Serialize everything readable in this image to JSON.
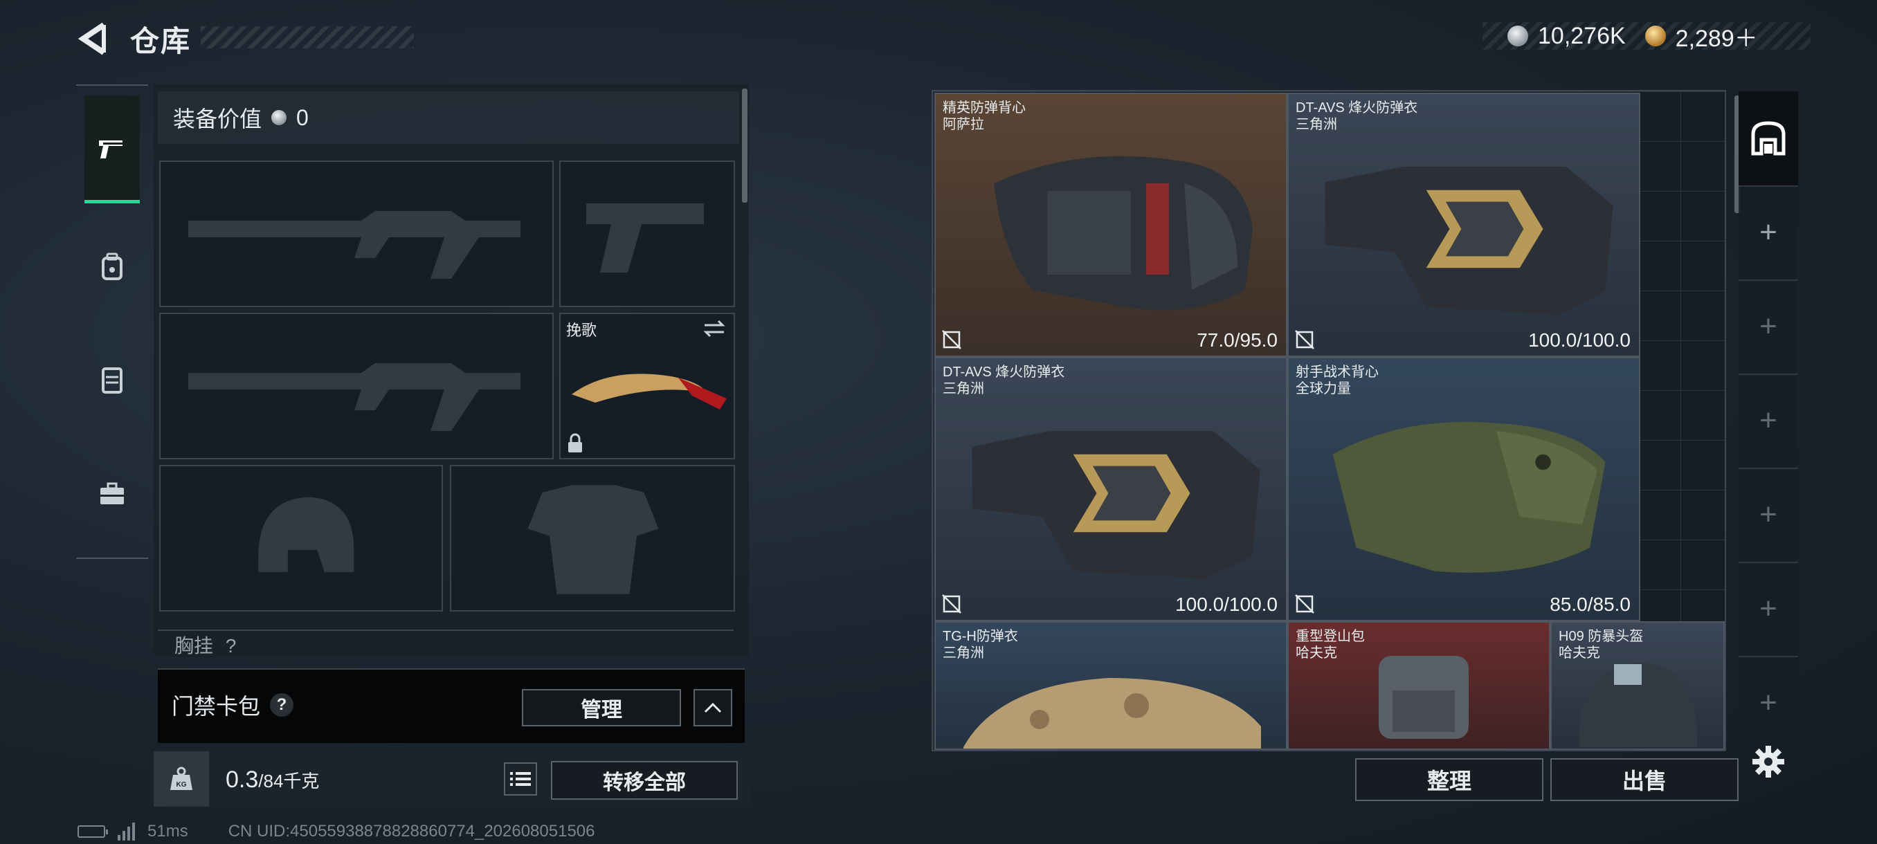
{
  "header": {
    "title": "仓库",
    "currency_silver": "10,276K",
    "currency_gold": "2,289＋"
  },
  "categories": [
    {
      "icon": "pistol-icon",
      "active": true
    },
    {
      "icon": "backpack-icon",
      "active": false
    },
    {
      "icon": "vest-icon",
      "active": false
    },
    {
      "icon": "toolbox-icon",
      "active": false
    }
  ],
  "loadout": {
    "equip_value_label": "装备价值",
    "equip_value": "0",
    "melee_name": "挽歌",
    "chest_rig_label": "胸挂",
    "chest_rig_help": "?"
  },
  "keycard": {
    "label": "门禁卡包",
    "help": "?",
    "manage": "管理"
  },
  "weight": {
    "current": "0.3",
    "max": "/84千克",
    "icon": "KG",
    "transfer_all": "转移全部"
  },
  "status": {
    "ping": "51ms",
    "uid": "CN UID:4505593887882886077​4_202608051506"
  },
  "stash": {
    "items": [
      {
        "name": "精英防弹背心",
        "sub": "阿萨拉",
        "durability": "77.0/95.0"
      },
      {
        "name": "DT-AVS 烽火防弹衣",
        "sub": "三角洲",
        "durability": "100.0/100.0"
      },
      {
        "name": "DT-AVS 烽火防弹衣",
        "sub": "三角洲",
        "durability": "100.0/100.0"
      },
      {
        "name": "射手战术背心",
        "sub": "全球力量",
        "durability": "85.0/85.0"
      },
      {
        "name": "TG-H防弹衣",
        "sub": "三角洲"
      },
      {
        "name": "重型登山包",
        "sub": "哈夫克"
      },
      {
        "name": "H09 防暴头盔",
        "sub": "哈夫克"
      }
    ],
    "side_add": "+",
    "sort": "整理",
    "sell": "出售"
  }
}
